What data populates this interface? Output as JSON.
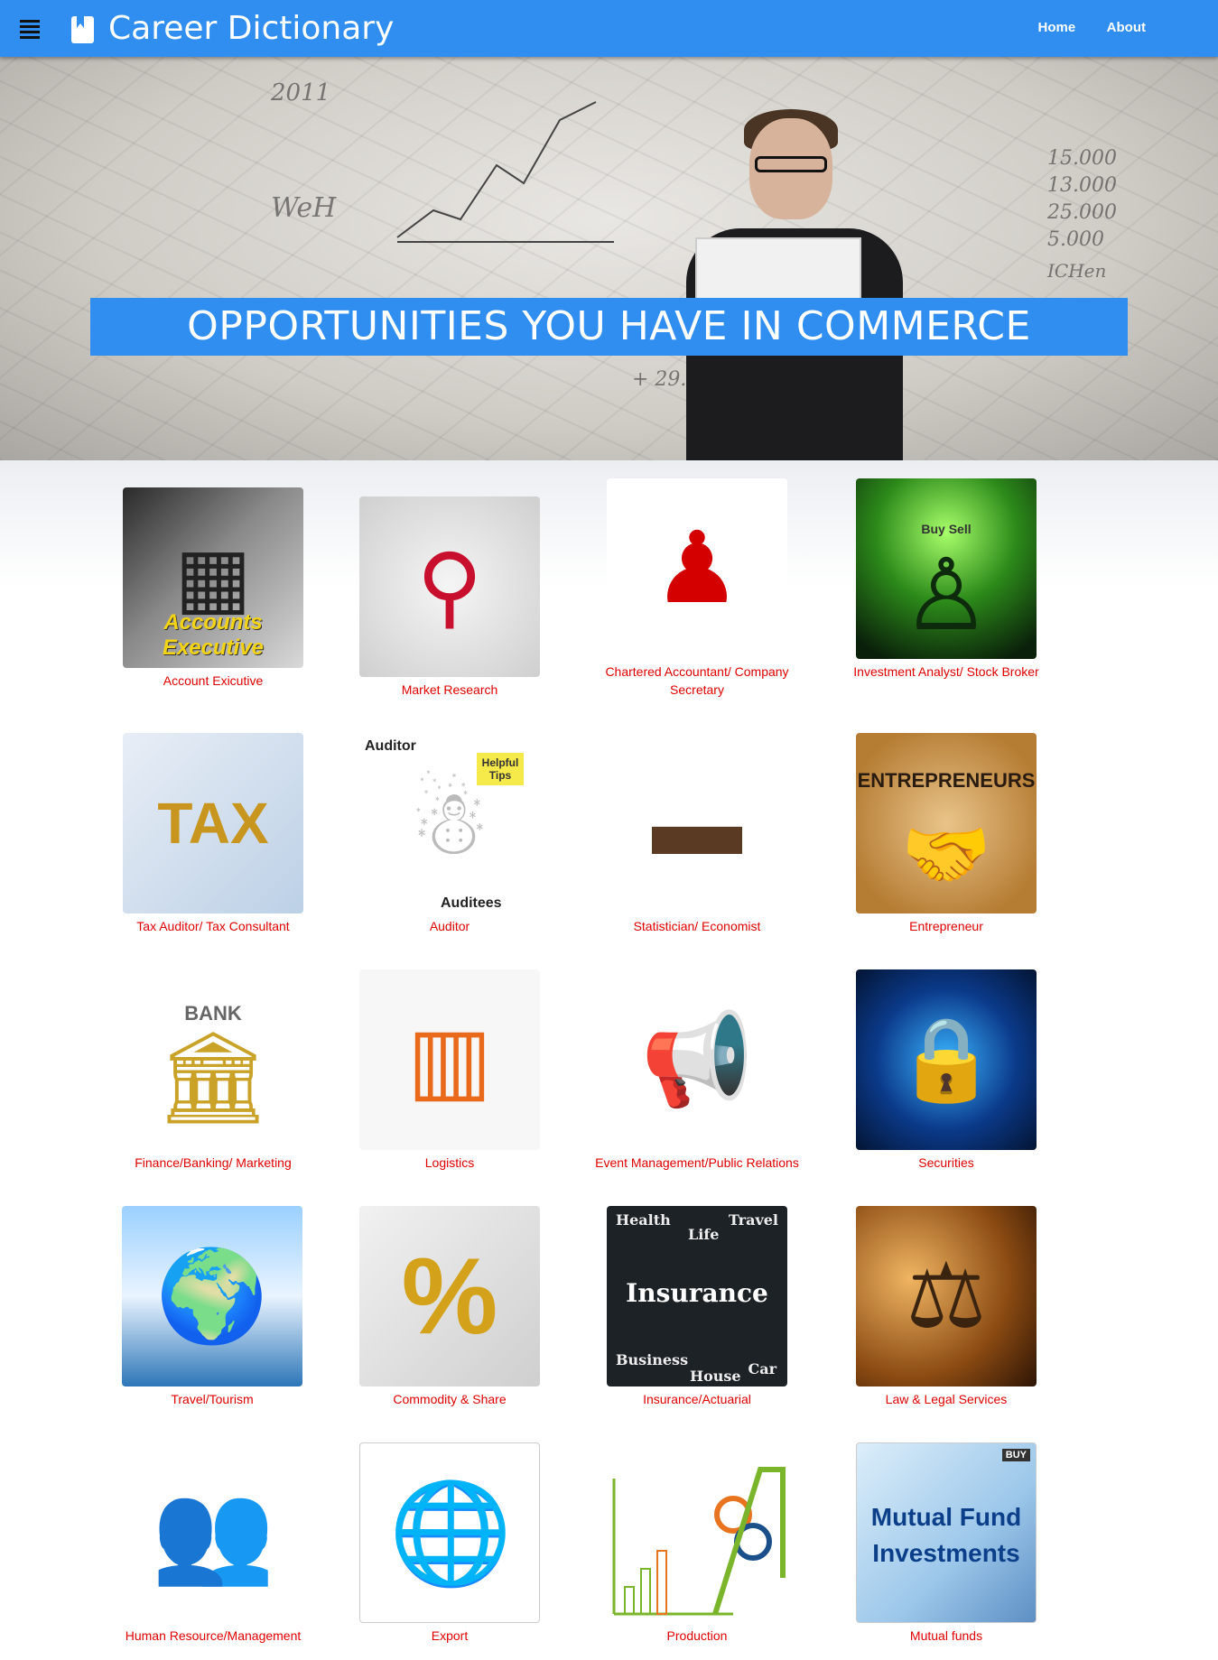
{
  "header": {
    "title": "Career Dictionary",
    "menu_icon": "hamburger-icon",
    "logo_icon": "bookmark-book-icon",
    "nav": [
      "Home",
      "About"
    ]
  },
  "hero": {
    "banner_text": "OPPORTUNITIES YOU HAVE IN COMMERCE",
    "scribbles": [
      "2011",
      "15.000",
      "13.000",
      "25.000",
      "5.000",
      "+ 29.000",
      "WeH",
      "ICHen"
    ]
  },
  "careers": [
    {
      "label": "Account Exicutive",
      "image_text": "Accounts Executive"
    },
    {
      "label": "Market Research",
      "image_text": ""
    },
    {
      "label": "Chartered Accountant/ Company Secretary",
      "image_text": ""
    },
    {
      "label": "Investment Analyst/ Stock Broker",
      "image_text": "Buy Sell"
    },
    {
      "label": "Tax Auditor/ Tax Consultant",
      "image_text": "TAX"
    },
    {
      "label": "Auditor",
      "image_text": "Auditor",
      "image_text_2": "Helpful Tips",
      "image_text_3": "Auditees"
    },
    {
      "label": "Statistician/ Economist",
      "image_text": ""
    },
    {
      "label": "Entrepreneur",
      "image_text": "ENTREPRENEURS"
    },
    {
      "label": "Finance/Banking/ Marketing",
      "image_text": "BANK"
    },
    {
      "label": "Logistics",
      "image_text": ""
    },
    {
      "label": "Event Management/Public Relations",
      "image_text": ""
    },
    {
      "label": "Securities",
      "image_text": ""
    },
    {
      "label": "Travel/Tourism",
      "image_text": ""
    },
    {
      "label": "Commodity & Share",
      "image_text": "%"
    },
    {
      "label": "Insurance/Actuarial",
      "image_text": "Insurance",
      "image_words": [
        "Health",
        "Life",
        "Travel",
        "Business",
        "House",
        "Car"
      ]
    },
    {
      "label": "Law & Legal Services",
      "image_text": ""
    },
    {
      "label": "Human Resource/Management",
      "image_text": ""
    },
    {
      "label": "Export",
      "image_text": ""
    },
    {
      "label": "Production",
      "image_text": ""
    },
    {
      "label": "Mutual funds",
      "image_text": "Mutual Fund Investments",
      "image_text_2": "BUY"
    }
  ],
  "colors": {
    "primary": "#2f8ef0",
    "label_red": "#e00000"
  }
}
